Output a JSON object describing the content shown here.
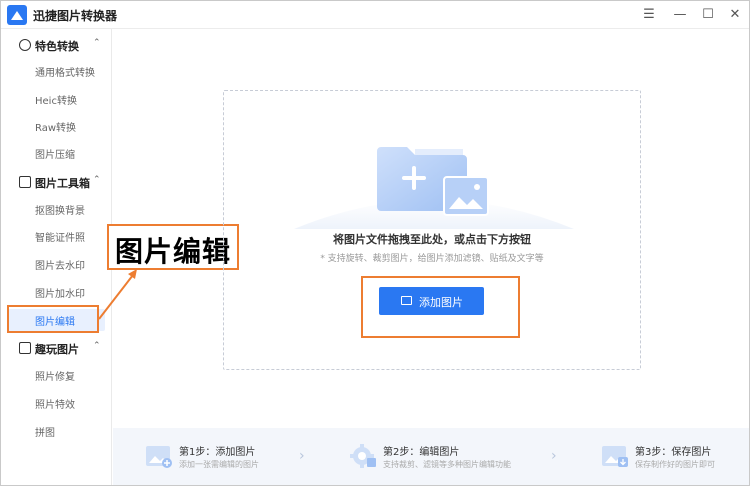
{
  "app": {
    "title": "迅捷图片转换器",
    "controls": {
      "menu": "☰",
      "minimize": "—",
      "maximize": "☐",
      "close": "✕"
    }
  },
  "sidebar": {
    "groups": [
      {
        "label": "特色转换",
        "icon": "convert-icon",
        "items": [
          "通用格式转换",
          "Heic转换",
          "Raw转换",
          "图片压缩"
        ]
      },
      {
        "label": "图片工具箱",
        "icon": "toolbox-icon",
        "items": [
          "抠图换背景",
          "智能证件照",
          "图片去水印",
          "图片加水印",
          "图片编辑"
        ]
      },
      {
        "label": "趣玩图片",
        "icon": "image-icon",
        "items": [
          "照片修复",
          "照片特效",
          "拼图"
        ]
      }
    ],
    "active_item": "图片编辑",
    "caret": "⌃"
  },
  "callout": {
    "text": "图片编辑"
  },
  "dropzone": {
    "title": "将图片文件拖拽至此处，或点击下方按钮",
    "subtitle": "* 支持旋转、裁剪图片，给图片添加滤镜、贴纸及文字等",
    "button_label": "添加图片"
  },
  "steps": [
    {
      "title": "第1步：添加图片",
      "desc": "添加一张需编辑的图片"
    },
    {
      "title": "第2步：编辑图片",
      "desc": "支持裁剪、滤镜等多种图片编辑功能"
    },
    {
      "title": "第3步：保存图片",
      "desc": "保存制作好的图片即可"
    }
  ],
  "step_arrow": "›",
  "colors": {
    "accent": "#2a78f2",
    "annotation": "#ed7d31",
    "steps_bg": "#f3f6fb"
  }
}
